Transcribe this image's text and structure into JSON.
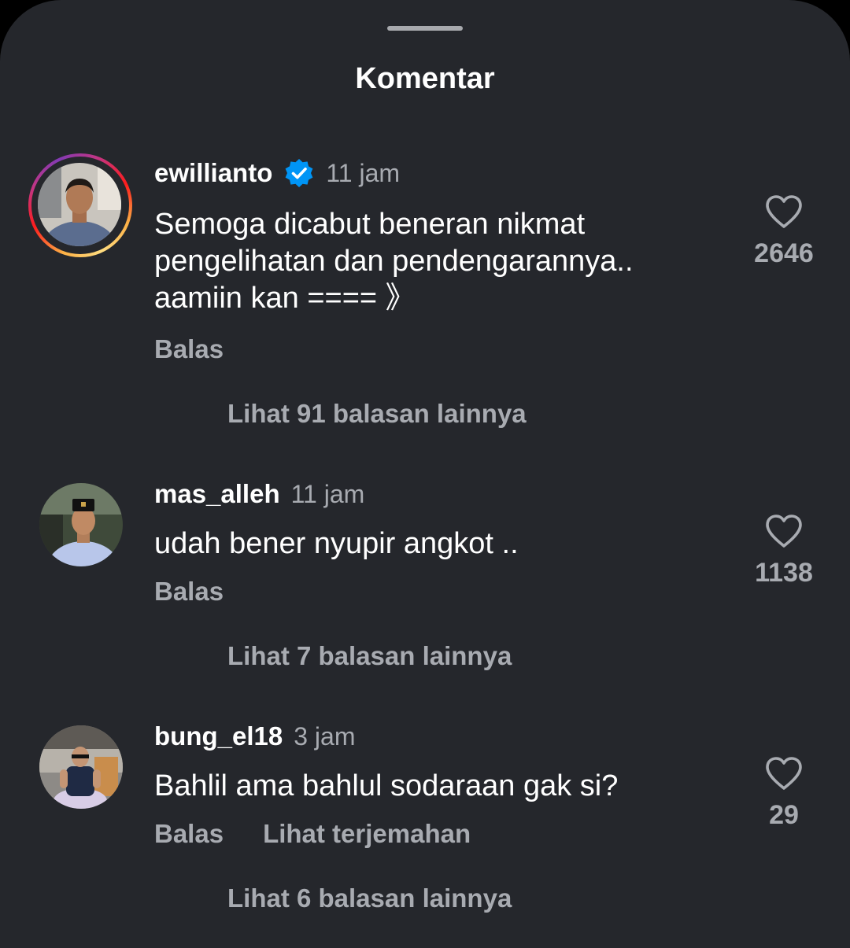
{
  "sheet": {
    "title": "Komentar"
  },
  "comments": [
    {
      "username": "ewillianto",
      "verified": true,
      "time": "11 jam",
      "text": "Semoga dicabut beneran nikmat pengelihatan dan pendengarannya.. aamiin kan ==== 》",
      "likes": "2646",
      "reply_label": "Balas",
      "view_replies": "Lihat 91 balasan lainnya"
    },
    {
      "username": "mas_alleh",
      "verified": false,
      "time": "11 jam",
      "text": "udah bener nyupir angkot ..",
      "likes": "1138",
      "reply_label": "Balas",
      "view_replies": "Lihat 7 balasan lainnya"
    },
    {
      "username": "bung_el18",
      "verified": false,
      "time": "3 jam",
      "text": "Bahlil ama bahlul sodaraan gak si?",
      "likes": "29",
      "reply_label": "Balas",
      "translate_label": "Lihat terjemahan",
      "view_replies": "Lihat 6 balasan lainnya"
    }
  ],
  "icons": {
    "handle": "drag-handle",
    "verified": "verified-badge-icon",
    "like": "heart-outline-icon"
  },
  "colors": {
    "background": "#25272c",
    "text_primary": "#ffffff",
    "text_secondary": "#a8abb1",
    "verified_blue": "#0095f6"
  }
}
